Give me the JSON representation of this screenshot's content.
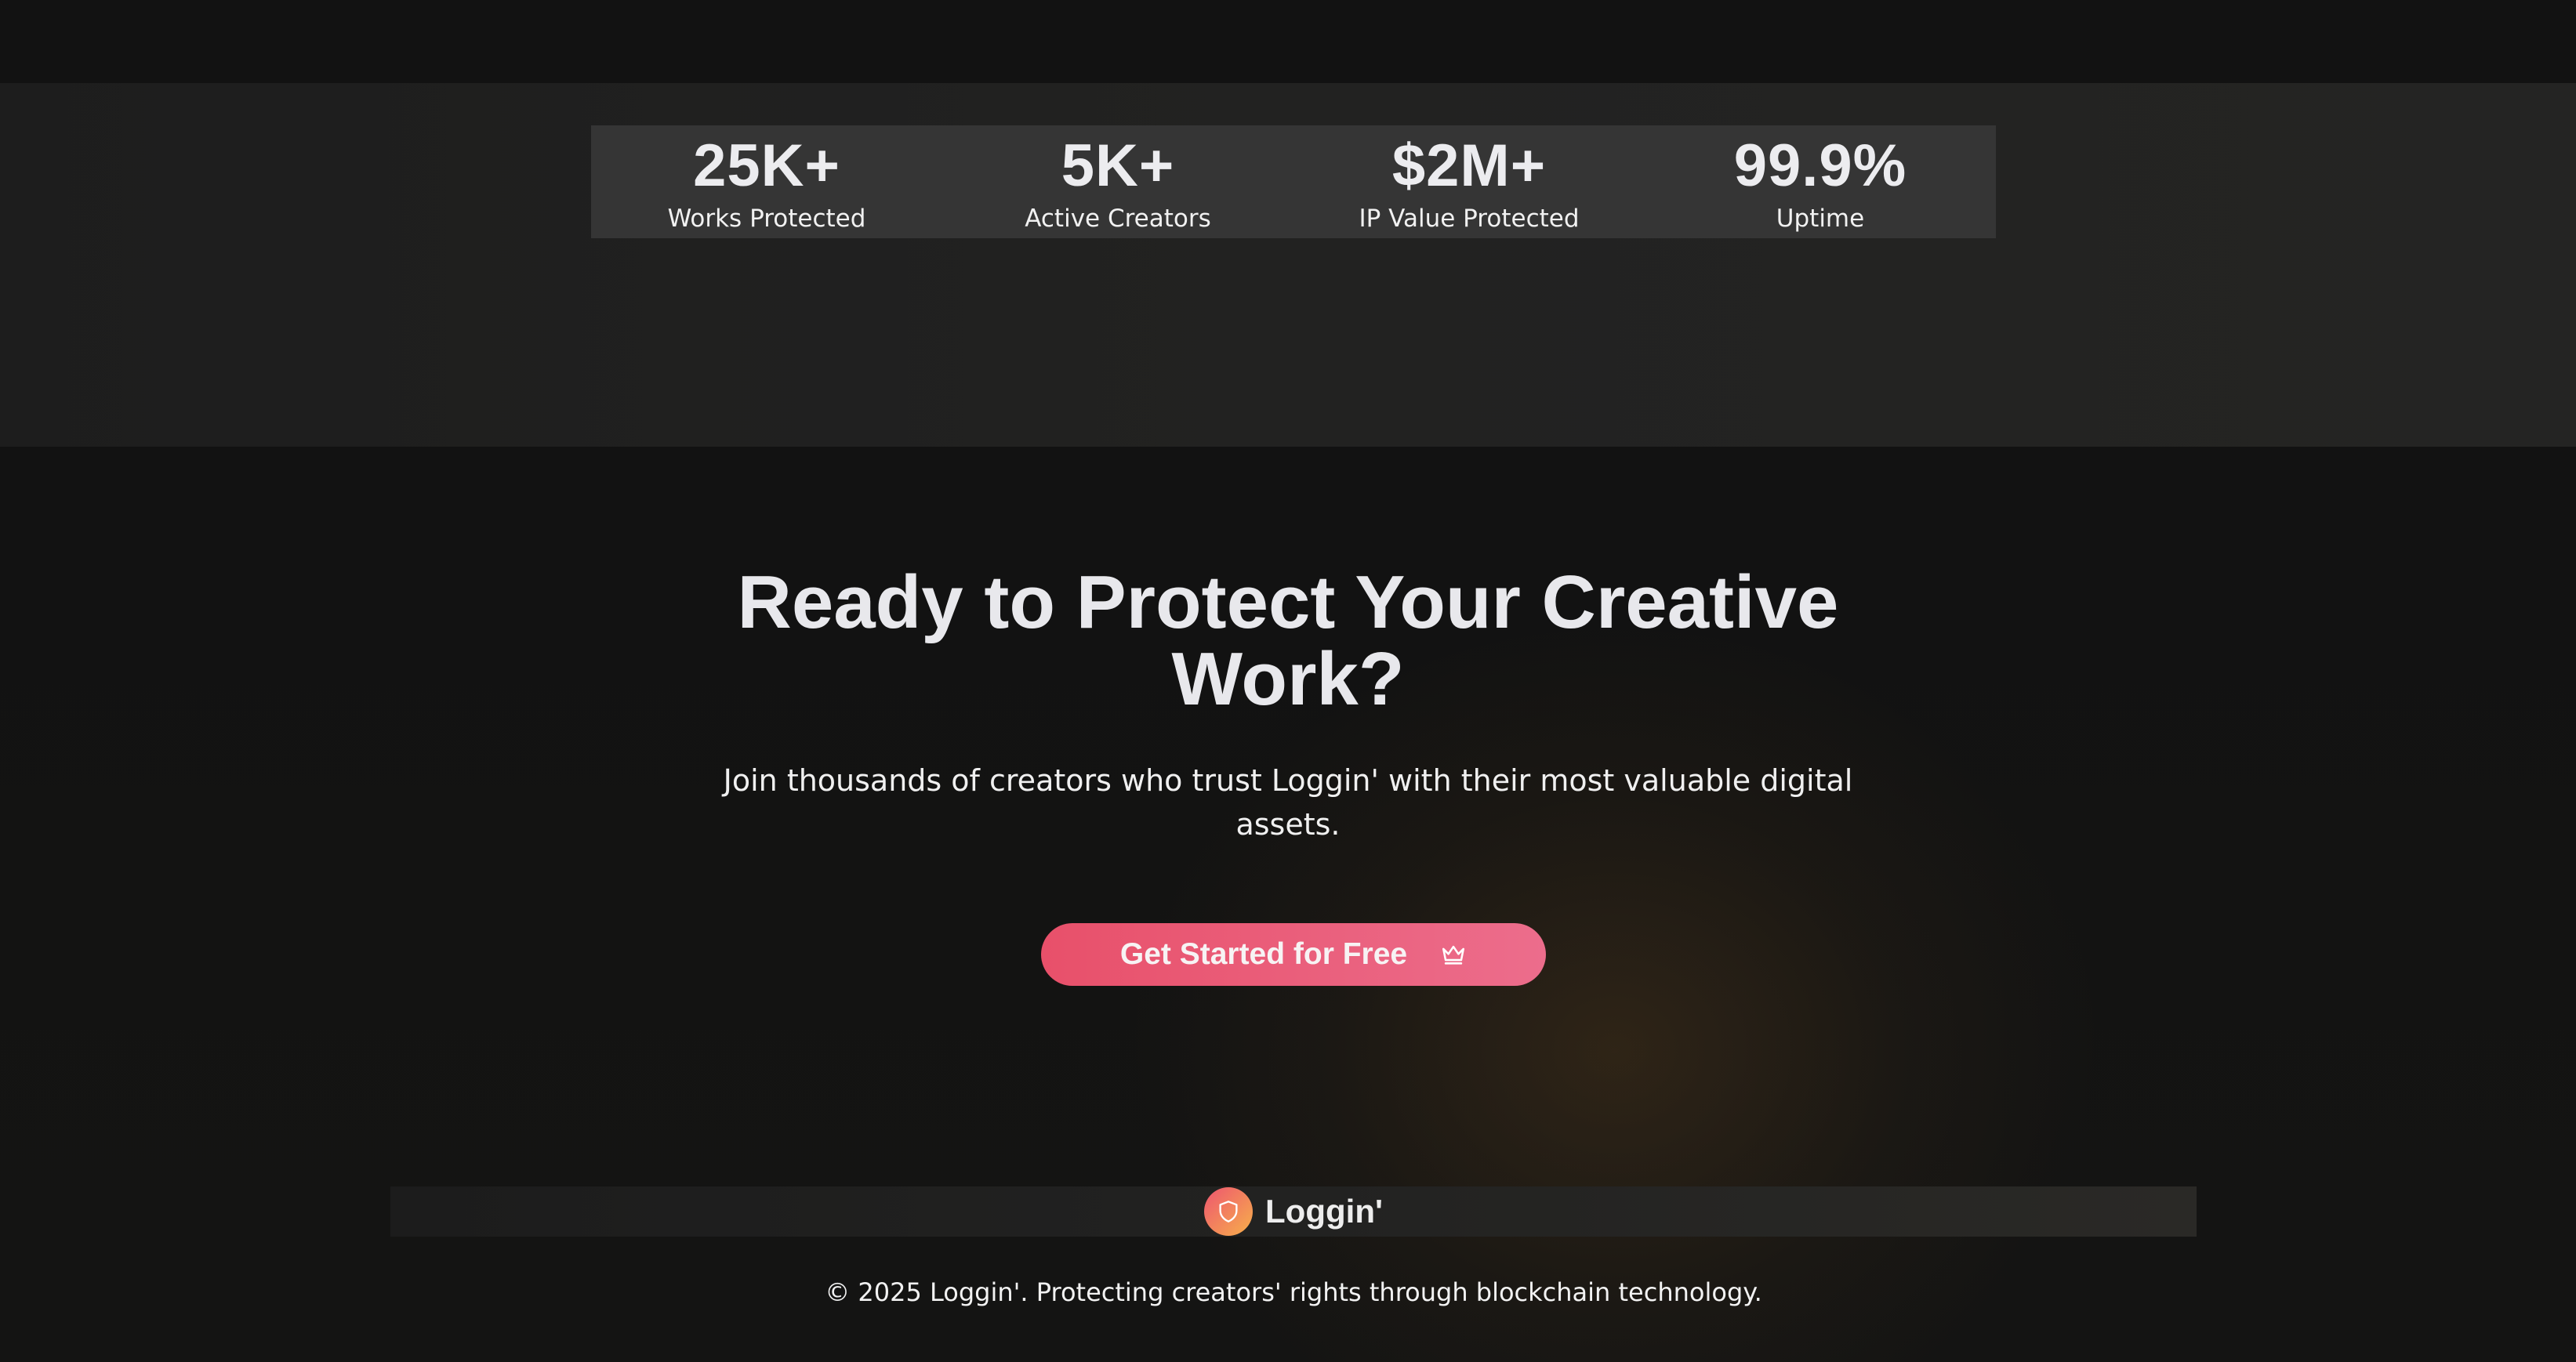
{
  "stats": [
    {
      "value": "25K+",
      "label": "Works Protected"
    },
    {
      "value": "5K+",
      "label": "Active Creators"
    },
    {
      "value": "$2M+",
      "label": "IP Value Protected"
    },
    {
      "value": "99.9%",
      "label": "Uptime"
    }
  ],
  "cta": {
    "title": "Ready to Protect Your Creative Work?",
    "subtitle": "Join thousands of creators who trust Loggin' with their most valuable digital assets.",
    "button_label": "Get Started for Free",
    "button_icon": "crown-icon"
  },
  "footer": {
    "brand_name": "Loggin'",
    "logo_icon": "shield-icon",
    "copyright": "© 2025 Loggin'. Protecting creators' rights through blockchain technology."
  },
  "colors": {
    "accent_start": "#e8506a",
    "accent_end": "#ec6d8c",
    "logo_gradient_start": "#ee5570",
    "logo_gradient_end": "#f7b04a",
    "background": "#121212"
  }
}
